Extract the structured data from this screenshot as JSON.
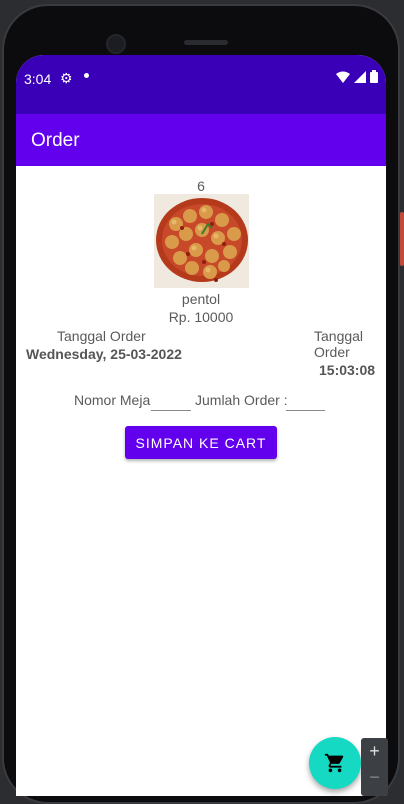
{
  "status_bar": {
    "time": "3:04"
  },
  "app_bar": {
    "title": "Order"
  },
  "order": {
    "item_id": "6",
    "item_name": "pentol",
    "item_price": "Rp. 10000",
    "date_label": "Tanggal Order",
    "date_value": "Wednesday, 25-03-2022",
    "time_label": "Tanggal Order",
    "time_value": "15:03:08",
    "table_label": "Nomor Meja",
    "table_value": "",
    "quantity_label": "Jumlah Order :",
    "quantity_value": "",
    "save_button": "SIMPAN KE CART"
  },
  "colors": {
    "status_bar": "#3a00b8",
    "primary": "#6200ee",
    "fab": "#16d9c3"
  },
  "icons": [
    "settings-icon",
    "wifi-icon",
    "signal-icon",
    "battery-icon",
    "cart-icon"
  ],
  "emulator_zoom": {
    "plus": "+",
    "minus": "−"
  }
}
